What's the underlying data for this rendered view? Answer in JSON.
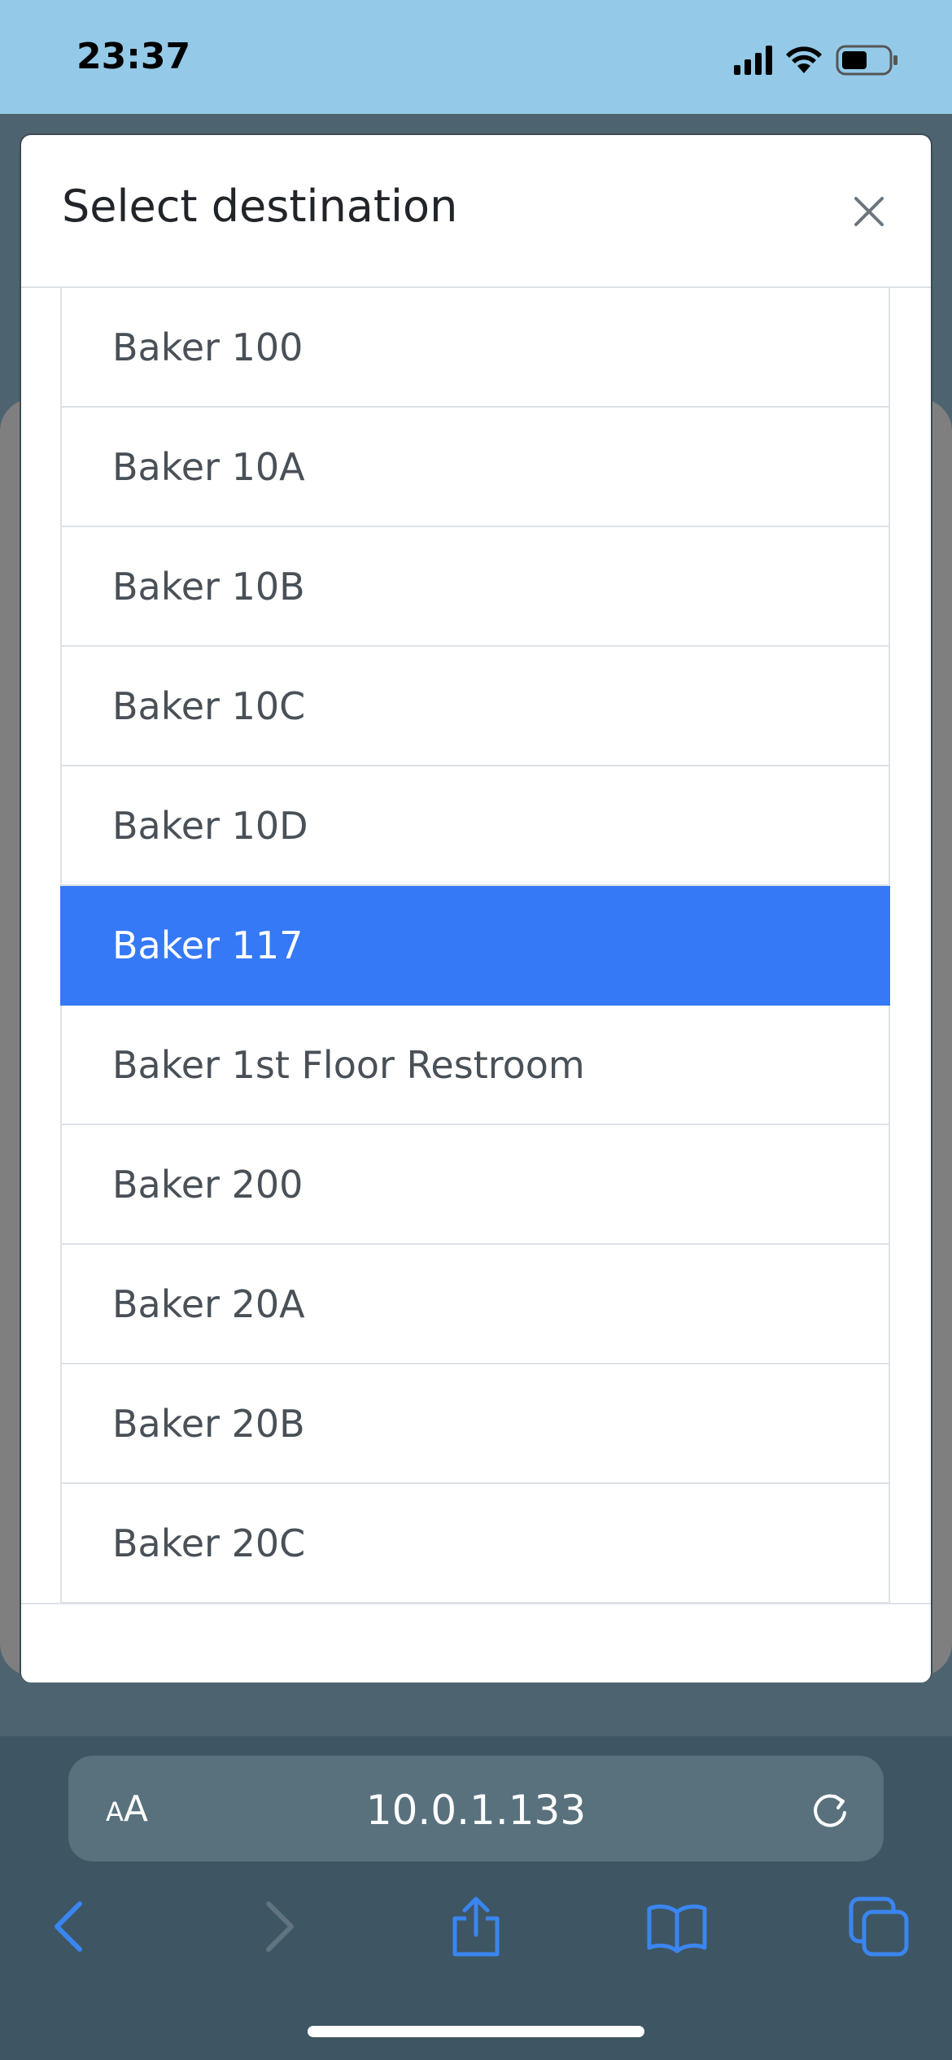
{
  "status_bar": {
    "time": "23:37"
  },
  "modal": {
    "title": "Select destination",
    "items": [
      {
        "label": "Baker 100"
      },
      {
        "label": "Baker 10A"
      },
      {
        "label": "Baker 10B"
      },
      {
        "label": "Baker 10C"
      },
      {
        "label": "Baker 10D"
      },
      {
        "label": "Baker 117"
      },
      {
        "label": "Baker 1st Floor Restroom"
      },
      {
        "label": "Baker 200"
      },
      {
        "label": "Baker 20A"
      },
      {
        "label": "Baker 20B"
      },
      {
        "label": "Baker 20C"
      }
    ],
    "selected_label": "Baker 117",
    "accent_color": "#3579f6"
  },
  "browser": {
    "text_size_label_small": "A",
    "text_size_label_large": "A",
    "url": "10.0.1.133",
    "icons": [
      "back-icon",
      "forward-icon",
      "share-icon",
      "bookmarks-icon",
      "tabs-icon",
      "reload-icon"
    ]
  }
}
